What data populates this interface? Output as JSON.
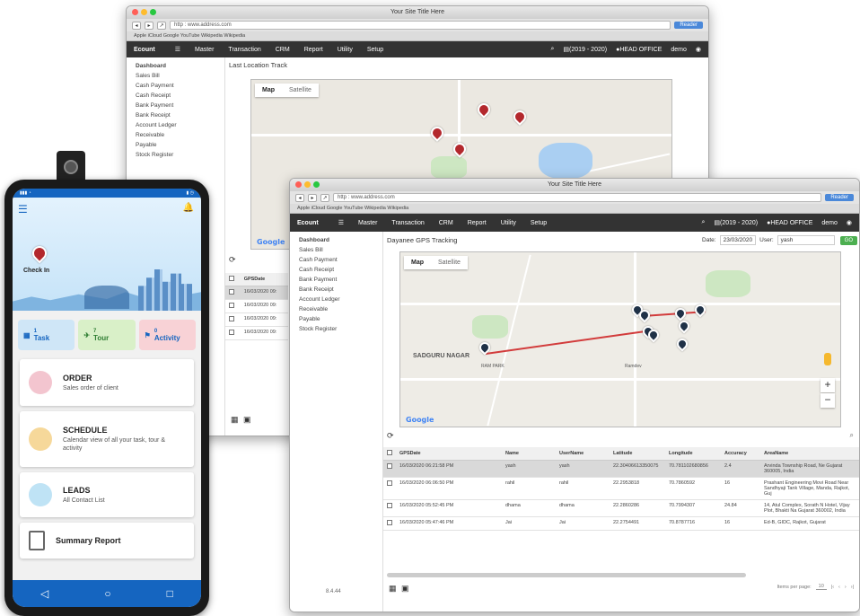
{
  "browser": {
    "title": "Your Site Title Here",
    "url": "http : www.address.com",
    "reader_label": "Reader",
    "bookmarks": "Apple    iCloud    Google    YouTube    Wikipedia    Wikipedia"
  },
  "app": {
    "logo": "Ecount",
    "menu": [
      "Master",
      "Transaction",
      "CRM",
      "Report",
      "Utility",
      "Setup"
    ],
    "year": "(2019 - 2020)",
    "branch": "HEAD OFFICE",
    "user": "demo"
  },
  "sidebar": [
    "Dashboard",
    "Sales Bill",
    "Cash Payment",
    "Cash Receipt",
    "Bank Payment",
    "Bank Receipt",
    "Account Ledger",
    "Receivable",
    "Payable",
    "Stock Register"
  ],
  "back_window": {
    "page_title": "Last Location Track",
    "map_tabs": [
      "Map",
      "Satellite"
    ],
    "table_header": "GPSDate",
    "rows": [
      "16/03/2020 09:",
      "16/03/2020 09:",
      "16/03/2020 09:",
      "16/03/2020 09:"
    ]
  },
  "front_window": {
    "page_title": "Dayanee GPS Tracking",
    "date_label": "Date:",
    "date_value": "23/03/2020",
    "user_label": "User:",
    "user_value": "yash",
    "go_label": "GO",
    "map_tabs": [
      "Map",
      "Satellite"
    ],
    "map_labels": [
      "SADGURU NAGAR",
      "RAM PARK",
      "Ramdev"
    ],
    "version": "8.4.44",
    "items_per_page_label": "Items per page:",
    "items_per_page": "10",
    "table": {
      "headers": [
        "GPSDate",
        "Name",
        "UserName",
        "Latitude",
        "Longitude",
        "Accuracy",
        "AreaName"
      ],
      "rows": [
        [
          "16/03/2020 06:21:58 PM",
          "yash",
          "yash",
          "22.30406613350075",
          "70.781102680856",
          "2.4",
          "Arvinda Township Road, Ne Gujarat 360005, India"
        ],
        [
          "16/03/2020 06:06:50 PM",
          "rahil",
          "rahil",
          "22.2953818",
          "70.7860592",
          "16",
          "Prashant Engineering Movi Road Near Sandhyaji Tank Village, Manda, Rajkot, Guj"
        ],
        [
          "16/03/2020 05:52:45 PM",
          "dhama",
          "dhama",
          "22.2860286",
          "70.7994307",
          "24.84",
          "14, Atul Complex, Sorath N Hotel, Vijay Plot, Bhakti Na Gujarat 360002, India"
        ],
        [
          "16/03/2020 05:47:46 PM",
          "Jai",
          "Jai",
          "22.2754491",
          "70.8787716",
          "16",
          "Ed-B, GIDC, Rajkot, Gujarat"
        ]
      ]
    }
  },
  "phone": {
    "checkin_label": "Check In",
    "tiles": [
      {
        "count": "1",
        "label": "Task"
      },
      {
        "count": "7",
        "label": "Tour"
      },
      {
        "count": "0",
        "label": "Activity"
      }
    ],
    "cards": [
      {
        "title": "ORDER",
        "subtitle": "Sales order of client"
      },
      {
        "title": "SCHEDULE",
        "subtitle": "Calendar view of all your task, tour & activity"
      },
      {
        "title": "LEADS",
        "subtitle": "All Contact List"
      },
      {
        "title": "Summary Report",
        "subtitle": ""
      }
    ]
  },
  "colors": {
    "appbar": "#333333",
    "pin_red": "#b3282d",
    "pin_dark": "#1f3147",
    "phone_blue": "#1565c0",
    "task_tile": "#cfe6f7",
    "tour_tile": "#d9f0c8",
    "activity_tile": "#f8d2d6"
  }
}
